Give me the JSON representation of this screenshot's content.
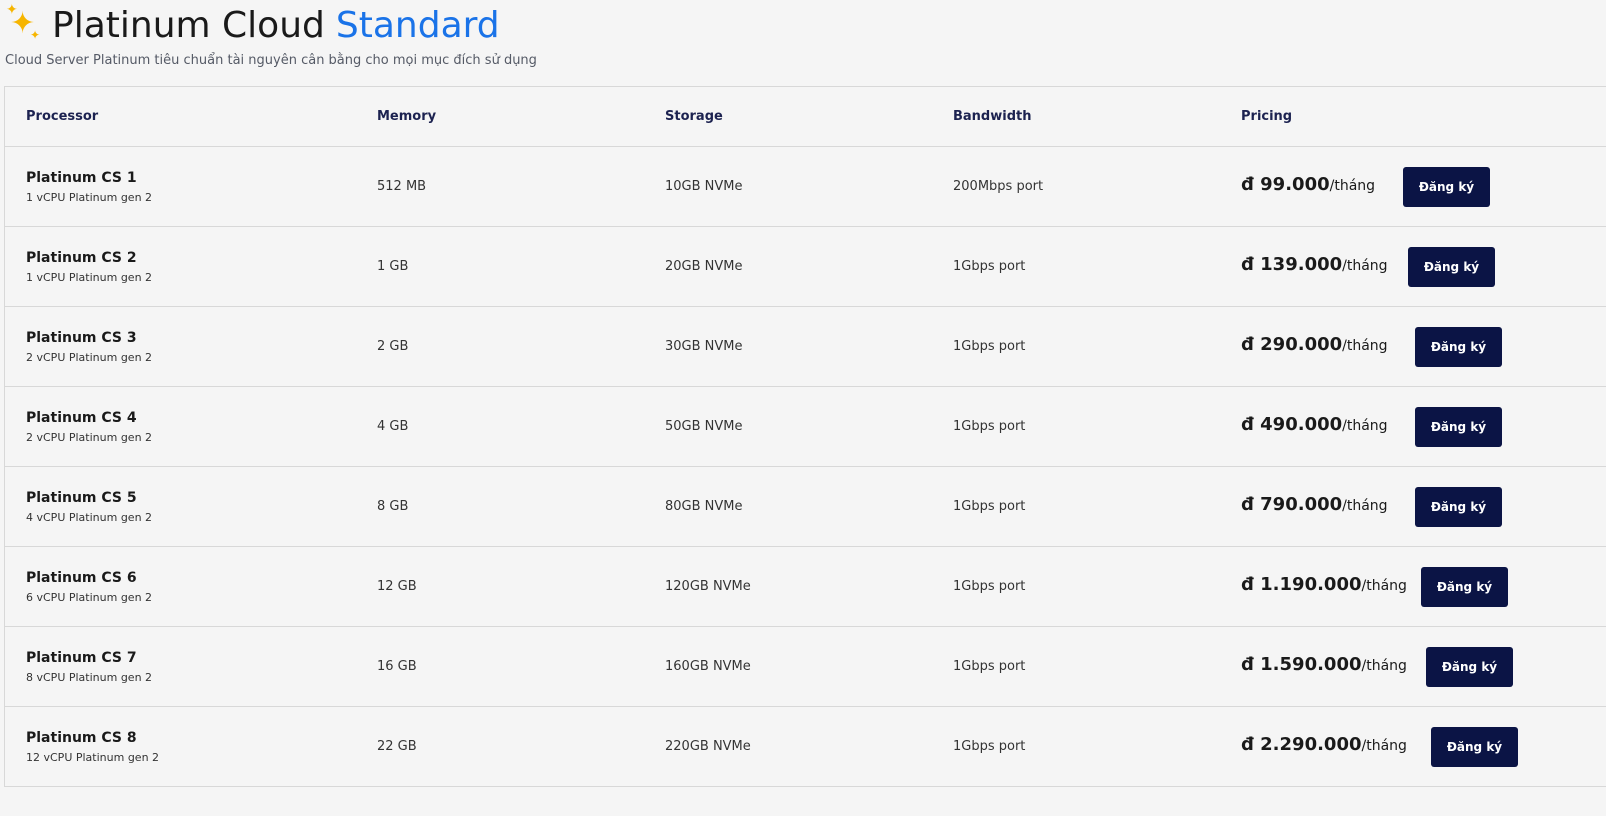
{
  "header": {
    "icon": "sparkles-icon",
    "title": "Platinum Cloud",
    "title_accent": "Standard",
    "subtitle": "Cloud Server Platinum tiêu chuẩn tài nguyên cân bằng cho mọi mục đích sử dụng",
    "accent_color": "#1a73e8"
  },
  "table": {
    "columns": [
      "Processor",
      "Memory",
      "Storage",
      "Bandwidth",
      "Pricing"
    ],
    "rows": [
      {
        "name": "Platinum CS 1",
        "cpu": "1 vCPU Platinum gen 2",
        "memory": "512 MB",
        "storage": "10GB NVMe",
        "bandwidth": "200Mbps port",
        "price": "đ 99.000",
        "unit": "/tháng",
        "button": "Đăng ký"
      },
      {
        "name": "Platinum CS 2",
        "cpu": "1 vCPU Platinum gen 2",
        "memory": "1 GB",
        "storage": "20GB NVMe",
        "bandwidth": "1Gbps port",
        "price": "đ 139.000",
        "unit": "/tháng",
        "button": "Đăng ký"
      },
      {
        "name": "Platinum CS 3",
        "cpu": "2 vCPU Platinum gen 2",
        "memory": "2 GB",
        "storage": "30GB NVMe",
        "bandwidth": "1Gbps port",
        "price": "đ 290.000",
        "unit": "/tháng",
        "button": "Đăng ký"
      },
      {
        "name": "Platinum CS 4",
        "cpu": "2 vCPU Platinum gen 2",
        "memory": "4 GB",
        "storage": "50GB NVMe",
        "bandwidth": "1Gbps port",
        "price": "đ 490.000",
        "unit": "/tháng",
        "button": "Đăng ký"
      },
      {
        "name": "Platinum CS 5",
        "cpu": "4 vCPU Platinum gen 2",
        "memory": "8 GB",
        "storage": "80GB NVMe",
        "bandwidth": "1Gbps port",
        "price": "đ 790.000",
        "unit": "/tháng",
        "button": "Đăng ký"
      },
      {
        "name": "Platinum CS 6",
        "cpu": "6 vCPU Platinum gen 2",
        "memory": "12 GB",
        "storage": "120GB NVMe",
        "bandwidth": "1Gbps port",
        "price": "đ 1.190.000",
        "unit": "/tháng",
        "button": "Đăng ký"
      },
      {
        "name": "Platinum CS 7",
        "cpu": "8 vCPU Platinum gen 2",
        "memory": "16 GB",
        "storage": "160GB NVMe",
        "bandwidth": "1Gbps port",
        "price": "đ 1.590.000",
        "unit": "/tháng",
        "button": "Đăng ký"
      },
      {
        "name": "Platinum CS 8",
        "cpu": "12 vCPU Platinum gen 2",
        "memory": "22 GB",
        "storage": "220GB NVMe",
        "bandwidth": "1Gbps port",
        "price": "đ 2.290.000",
        "unit": "/tháng",
        "button": "Đăng ký"
      }
    ]
  },
  "colors": {
    "button_bg": "#0b1445",
    "header_text": "#1c2250"
  }
}
